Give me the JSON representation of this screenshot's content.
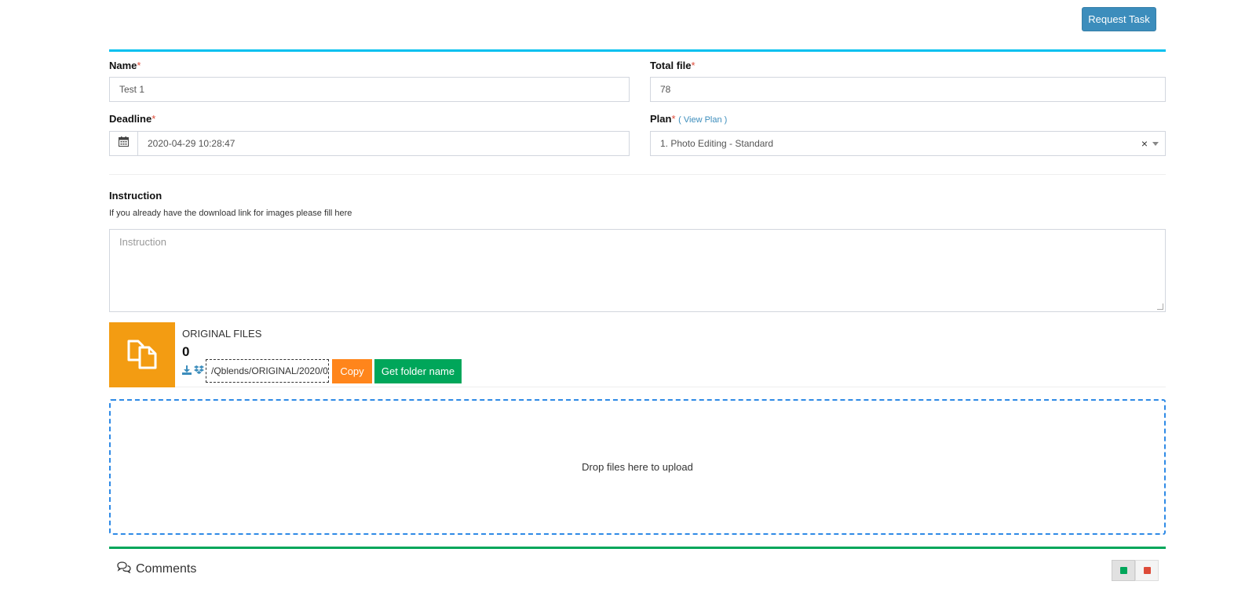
{
  "header": {
    "request_task_label": "Request Task"
  },
  "form": {
    "name": {
      "label": "Name",
      "required_mark": "*",
      "value": "Test 1"
    },
    "total_file": {
      "label": "Total file",
      "required_mark": "*",
      "value": "78"
    },
    "deadline": {
      "label": "Deadline",
      "required_mark": "*",
      "value": "2020-04-29 10:28:47",
      "icon": "calendar-icon"
    },
    "plan": {
      "label": "Plan",
      "required_mark": "*",
      "view_plan_link": "( View Plan )",
      "value": "1. Photo Editing - Standard",
      "clear_symbol": "×"
    }
  },
  "instruction": {
    "label": "Instruction",
    "help_text": "If you already have the download link for images please fill here",
    "placeholder": "Instruction",
    "value": ""
  },
  "original_files": {
    "title": "ORIGINAL FILES",
    "count": "0",
    "path": "/Qblends/ORIGINAL/2020/0",
    "copy_label": "Copy",
    "get_folder_label": "Get folder name",
    "icons": [
      "files-icon",
      "download-icon",
      "dropbox-icon"
    ],
    "accent_color": "#f39c12"
  },
  "dropzone": {
    "message": "Drop files here to upload"
  },
  "comments": {
    "title": "Comments",
    "icon": "comments-icon",
    "toolbar_colors": [
      "#00a65a",
      "#dd4b39"
    ]
  },
  "colors": {
    "primary": "#3c8dbc",
    "info_border": "#00c0ef",
    "success": "#00a65a",
    "orange": "#ff851b",
    "danger": "#dd4b39"
  }
}
